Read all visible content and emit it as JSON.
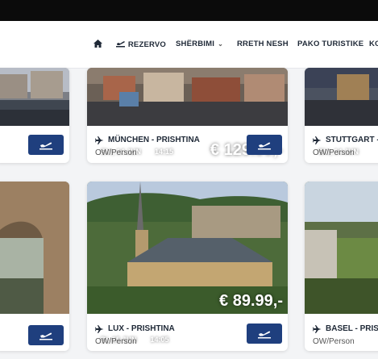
{
  "nav": {
    "home_icon": "home-icon",
    "items": [
      {
        "label": "REZERVO",
        "icon": "plane-icon"
      },
      {
        "label": "SHËRBIMI"
      },
      {
        "label": "RRETH NESH"
      },
      {
        "label": "PAKO TURISTIKE"
      },
      {
        "label": "KO"
      }
    ]
  },
  "cards": {
    "munich": {
      "date": "Sht, 14 JUN",
      "time": "14:15",
      "price": "€ 129.99,-",
      "route": "MÜNCHEN - PRISHTINA",
      "sub": "OW/Person"
    },
    "stuttgart": {
      "date": "Sht, 14 JUN",
      "route": "STUTTGART -",
      "sub": "OW/Person"
    },
    "lux": {
      "date": "Di, 15 JUN",
      "time": "14:05",
      "price": "€ 89.99,-",
      "route": "LUX - PRISHTINA",
      "sub": "OW/Person"
    },
    "basel": {
      "route": "BASEL - PRIS",
      "sub": "OW/Person"
    }
  },
  "colors": {
    "button": "#1f3f7e",
    "topbar": "#0b0b0b"
  }
}
